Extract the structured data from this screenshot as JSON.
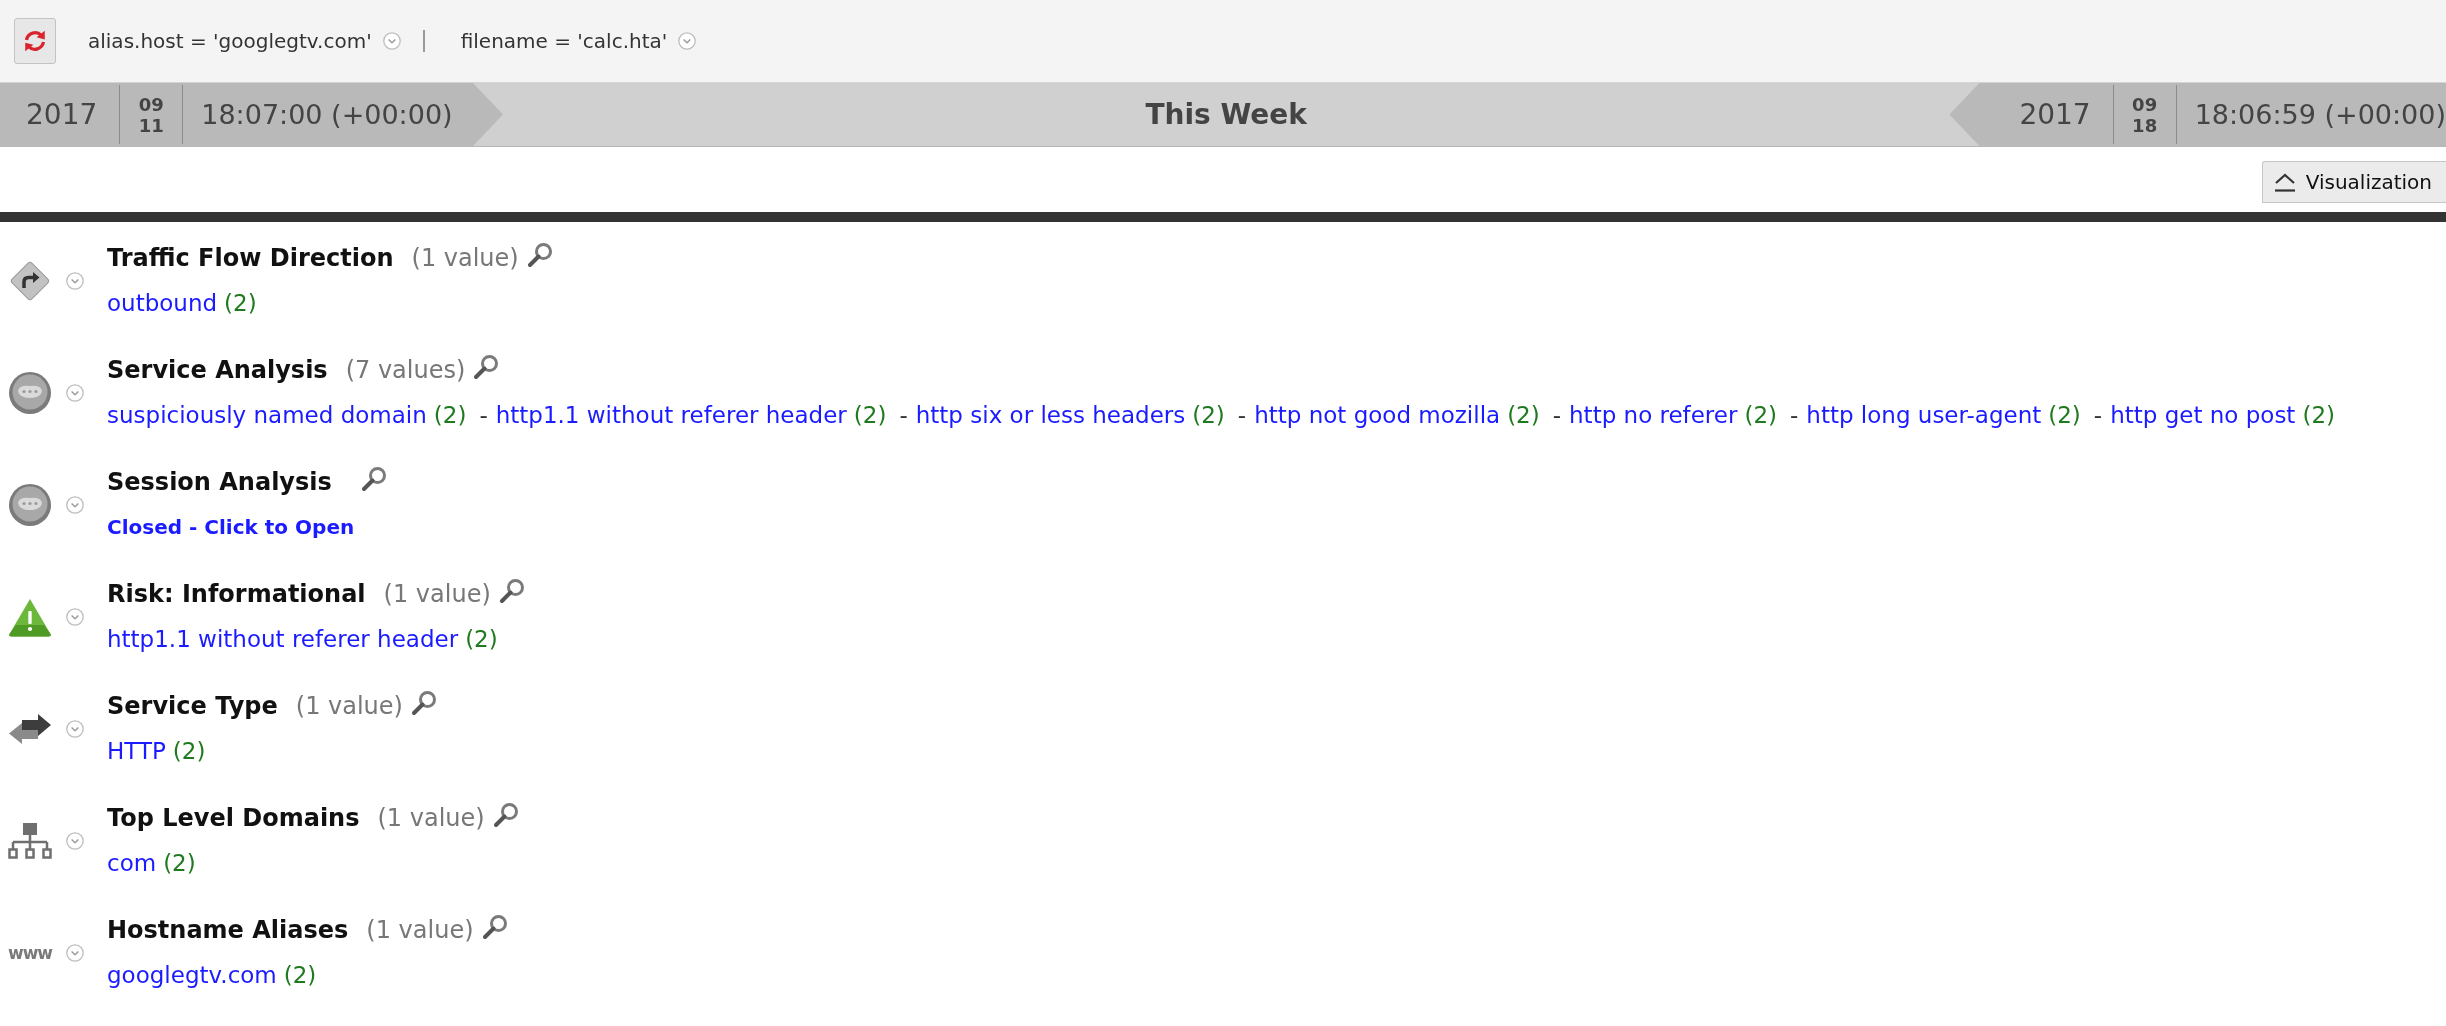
{
  "toolbar": {
    "filters": [
      {
        "text": "alias.host = 'googlegtv.com'"
      },
      {
        "text": "filename = 'calc.hta'"
      }
    ]
  },
  "timeline": {
    "start": {
      "year": "2017",
      "month": "09",
      "day": "11",
      "time": "18:07:00 (+00:00)"
    },
    "range": "This Week",
    "end": {
      "year": "2017",
      "month": "09",
      "day": "18",
      "time": "18:06:59 (+00:00)"
    }
  },
  "visualization_button": {
    "label": "Visualization"
  },
  "sections": [
    {
      "kind": "direction",
      "title": "Traffic Flow Direction",
      "count": "(1 value)",
      "closed": false,
      "values": [
        {
          "label": "outbound",
          "count": "(2)"
        }
      ]
    },
    {
      "kind": "analysis",
      "title": "Service Analysis",
      "count": "(7 values)",
      "closed": false,
      "separator": "-",
      "values": [
        {
          "label": "suspiciously named domain",
          "count": "(2)"
        },
        {
          "label": "http1.1 without referer header",
          "count": "(2)"
        },
        {
          "label": "http six or less headers",
          "count": "(2)"
        },
        {
          "label": "http not good mozilla",
          "count": "(2)"
        },
        {
          "label": "http no referer",
          "count": "(2)"
        },
        {
          "label": "http long user-agent",
          "count": "(2)"
        },
        {
          "label": "http get no post",
          "count": "(2)"
        }
      ]
    },
    {
      "kind": "analysis",
      "title": "Session Analysis",
      "closed": true,
      "toggle_label": "Closed - Click to Open"
    },
    {
      "kind": "risk",
      "title": "Risk: Informational",
      "count": "(1 value)",
      "closed": false,
      "values": [
        {
          "label": "http1.1 without referer header",
          "count": "(2)"
        }
      ]
    },
    {
      "kind": "service",
      "title": "Service Type",
      "count": "(1 value)",
      "closed": false,
      "values": [
        {
          "label": "HTTP",
          "count": "(2)"
        }
      ]
    },
    {
      "kind": "domain",
      "title": "Top Level Domains",
      "count": "(1 value)",
      "closed": false,
      "values": [
        {
          "label": "com",
          "count": "(2)"
        }
      ]
    },
    {
      "kind": "hostname",
      "title": "Hostname Aliases",
      "count": "(1 value)",
      "closed": false,
      "icon_text": "www",
      "values": [
        {
          "label": "googlegtv.com",
          "count": "(2)"
        }
      ]
    }
  ]
}
